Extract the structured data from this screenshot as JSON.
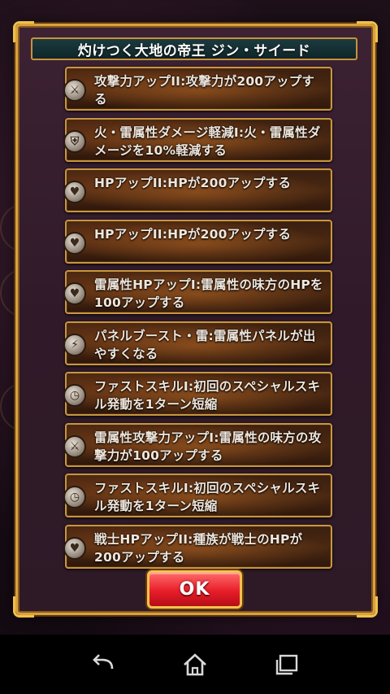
{
  "dialog": {
    "title": "灼けつく大地の帝王 ジン・サイード",
    "skills": [
      {
        "text": "攻撃力アップII:攻撃力が200アップする",
        "icon": "sword-icon"
      },
      {
        "text": "火・雷属性ダメージ軽減I:火・雷属性ダメージを10%軽減する",
        "icon": "shield-icon"
      },
      {
        "text": "HPアップII:HPが200アップする",
        "icon": "heart-icon"
      },
      {
        "text": "HPアップII:HPが200アップする",
        "icon": "heart-icon"
      },
      {
        "text": "雷属性HPアップI:雷属性の味方のHPを100アップする",
        "icon": "heart-icon"
      },
      {
        "text": "パネルブースト・雷:雷属性パネルが出やすくなる",
        "icon": "lightning-icon"
      },
      {
        "text": "ファストスキルI:初回のスペシャルスキル発動を1ターン短縮",
        "icon": "clock-icon"
      },
      {
        "text": "雷属性攻撃力アップI:雷属性の味方の攻撃力が100アップする",
        "icon": "sword-icon"
      },
      {
        "text": "ファストスキルI:初回のスペシャルスキル発動を1ターン短縮",
        "icon": "clock-icon"
      },
      {
        "text": "戦士HPアップII:種族が戦士のHPが200アップする",
        "icon": "heart-icon"
      }
    ],
    "ok_label": "OK"
  },
  "nav": {
    "back_icon": "back-icon",
    "home_icon": "home-icon",
    "recents_icon": "recents-icon"
  },
  "colors": {
    "frame_gold": "#d8a23c",
    "title_bg": "#1b3a3f",
    "ok_red": "#e81e2a"
  }
}
